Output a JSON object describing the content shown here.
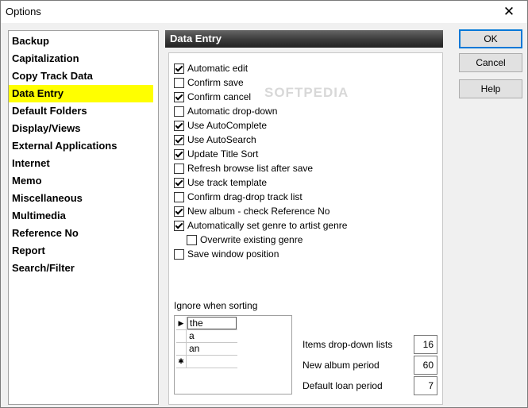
{
  "window": {
    "title": "Options",
    "close_glyph": "✕"
  },
  "sidebar": {
    "items": [
      {
        "label": "Backup"
      },
      {
        "label": "Capitalization"
      },
      {
        "label": "Copy Track Data"
      },
      {
        "label": "Data Entry",
        "selected": true
      },
      {
        "label": "Default Folders"
      },
      {
        "label": "Display/Views"
      },
      {
        "label": "External Applications"
      },
      {
        "label": "Internet"
      },
      {
        "label": "Memo"
      },
      {
        "label": "Miscellaneous"
      },
      {
        "label": "Multimedia"
      },
      {
        "label": "Reference No"
      },
      {
        "label": "Report"
      },
      {
        "label": "Search/Filter"
      }
    ],
    "selected_highlight": "#ffff00"
  },
  "panel": {
    "title": "Data Entry",
    "watermark": "SOFTPEDIA",
    "options": [
      {
        "label": "Automatic edit",
        "checked": true
      },
      {
        "label": "Confirm save",
        "checked": false
      },
      {
        "label": "Confirm cancel",
        "checked": true
      },
      {
        "label": "Automatic drop-down",
        "checked": false
      },
      {
        "label": "Use AutoComplete",
        "checked": true
      },
      {
        "label": "Use AutoSearch",
        "checked": true
      },
      {
        "label": "Update Title Sort",
        "checked": true
      },
      {
        "label": "Refresh browse list after save",
        "checked": false
      },
      {
        "label": "Use track template",
        "checked": true
      },
      {
        "label": "Confirm drag-drop track list",
        "checked": false
      },
      {
        "label": "New album - check Reference No",
        "checked": true
      },
      {
        "label": "Automatically set genre to artist genre",
        "checked": true
      },
      {
        "label": "Overwrite existing genre",
        "checked": false,
        "indent": true
      },
      {
        "label": "Save window position",
        "checked": false
      }
    ],
    "ignore_sorting": {
      "label": "Ignore when sorting",
      "rows": [
        {
          "indicator": "▶",
          "value": "the"
        },
        {
          "indicator": "",
          "value": "a"
        },
        {
          "indicator": "",
          "value": "an"
        },
        {
          "indicator": "✱",
          "value": ""
        }
      ]
    },
    "numbers": [
      {
        "label": "Items drop-down lists",
        "value": "16"
      },
      {
        "label": "New album period",
        "value": "60"
      },
      {
        "label": "Default loan period",
        "value": "7"
      }
    ]
  },
  "buttons": {
    "ok": "OK",
    "cancel": "Cancel",
    "help": "Help"
  },
  "colors": {
    "accent": "#0078d7",
    "header_dark": "#333333"
  }
}
